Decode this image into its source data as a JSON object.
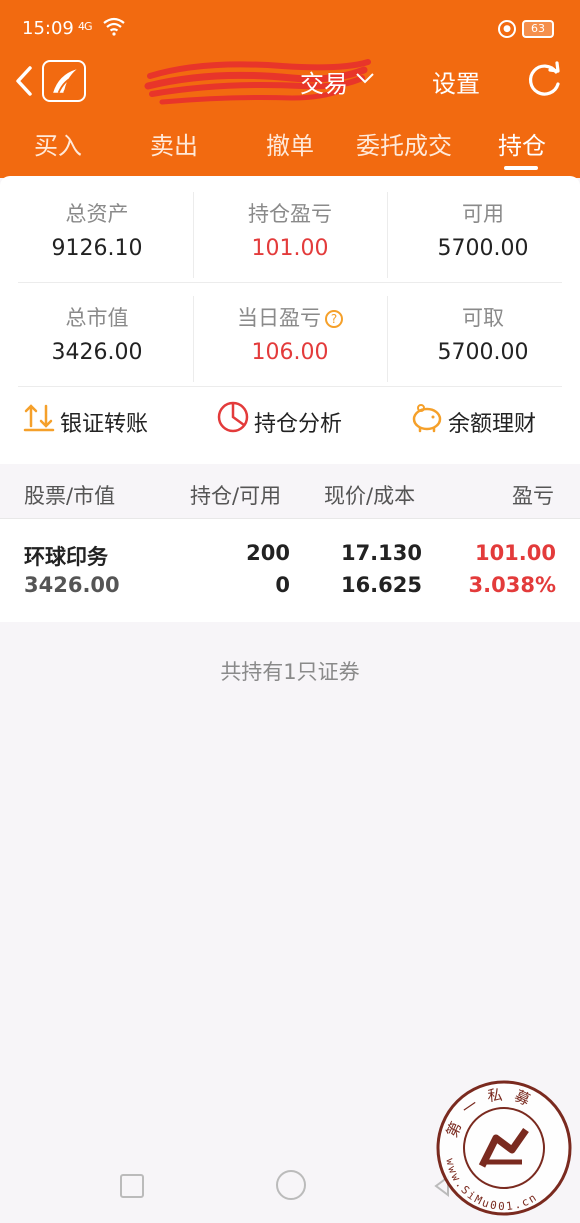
{
  "status_bar": {
    "time": "15:09",
    "signal": "4G",
    "battery": "63"
  },
  "header": {
    "account_suffix": "交易",
    "settings_label": "设置",
    "tabs": [
      {
        "label": "买入"
      },
      {
        "label": "卖出"
      },
      {
        "label": "撤单"
      },
      {
        "label": "委托成交"
      },
      {
        "label": "持仓"
      }
    ],
    "active_tab": "持仓"
  },
  "summary": {
    "total_assets": {
      "label": "总资产",
      "value": "9126.10"
    },
    "position_pnl": {
      "label": "持仓盈亏",
      "value": "101.00"
    },
    "available": {
      "label": "可用",
      "value": "5700.00"
    },
    "market_value": {
      "label": "总市值",
      "value": "3426.00"
    },
    "daily_pnl": {
      "label": "当日盈亏",
      "value": "106.00"
    },
    "withdrawable": {
      "label": "可取",
      "value": "5700.00"
    }
  },
  "actions": [
    {
      "label": "银证转账",
      "icon": "transfer-icon"
    },
    {
      "label": "持仓分析",
      "icon": "pie-chart-icon"
    },
    {
      "label": "余额理财",
      "icon": "piggy-bank-icon"
    }
  ],
  "holdings": {
    "columns": [
      "股票/市值",
      "持仓/可用",
      "现价/成本",
      "盈亏"
    ],
    "rows": [
      {
        "name": "环球印务",
        "market_value": "3426.00",
        "position": "200",
        "available": "0",
        "price": "17.130",
        "cost": "16.625",
        "pnl": "101.00",
        "pnl_pct": "3.038%"
      }
    ],
    "count_text": "共持有1只证券"
  },
  "watermark": {
    "top": "第一私募",
    "bottom": "www.SiMu001.cn"
  },
  "colors": {
    "brand": "#f26a10",
    "loss_gain_red": "#e33b3b",
    "accent_yellow": "#f5a02a"
  }
}
